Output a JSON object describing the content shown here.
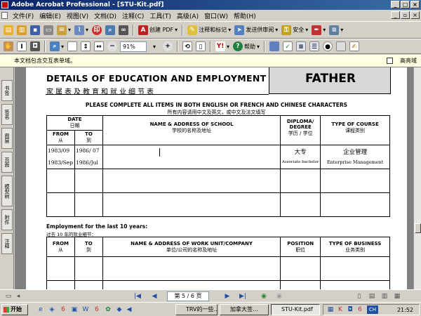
{
  "window": {
    "title": "Adobe Acrobat Professional - [STU-Kit.pdf]"
  },
  "menu": [
    "文件(F)",
    "编辑(E)",
    "视图(V)",
    "文档(D)",
    "注释(C)",
    "工具(T)",
    "高级(A)",
    "窗口(W)",
    "帮助(H)"
  ],
  "toolbar1": {
    "create_pdf": "创建 PDF",
    "comment": "注释和标记",
    "send_review": "发送供审阅",
    "security": "安全"
  },
  "toolbar2": {
    "zoom": "91%",
    "help": "帮助"
  },
  "message_bar": {
    "text": "本文档包含交互表单域。",
    "highlight_label": "高亮域"
  },
  "left_tabs": [
    "书签",
    "签名",
    "图层",
    "页面",
    "模型树",
    "附件",
    "注释"
  ],
  "document": {
    "title": "DETAILS OF EDUCATION AND EMPLOYMENT",
    "title_cn": "家属表及教育和就业细节表",
    "father": "FATHER",
    "instruction": "PLEASE COMPLETE ALL ITEMS IN BOTH ENGLISH OR FRENCH AND CHINESE CHARACTERS",
    "instruction_cn": "所有内容请用中文及英文，或中文及法文填写",
    "education": {
      "date": "DATE",
      "date_cn": "日期",
      "from": "FROM",
      "from_cn": "从",
      "to": "TO",
      "to_cn": "到",
      "school": "NAME & ADDRESS OF SCHOOL",
      "school_cn": "学校的名称及地址",
      "diploma": "DIPLOMA/ DEGREE",
      "diploma_cn": "学历 / 学位",
      "course": "TYPE OF COURSE",
      "course_cn": "课程类别",
      "row1": {
        "from": "1983/09",
        "to": "1986/ 07",
        "diploma": "大专",
        "course": "企业管理"
      },
      "row2": {
        "from": "1983/Sep",
        "to": "1986/Jul",
        "diploma": "Associate bachelor",
        "course": "Enterprise  Management"
      }
    },
    "employment": {
      "title": "Employment for the last 10 years:",
      "title_cn": "过去 10 年的就业细节：",
      "from": "FROM",
      "from_cn": "从",
      "to": "TO",
      "to_cn": "到",
      "company": "NAME & ADDRESS OF WORK UNIT/COMPANY",
      "company_cn": "单位/公司的名称及地址",
      "position": "POSITION",
      "position_cn": "职位",
      "business": "TYPE OF BUSINESS",
      "business_cn": "业务类别"
    }
  },
  "statusbar": {
    "page": "第 5 / 6 页"
  },
  "taskbar": {
    "start": "开始",
    "tasks": [
      "TRV的一些...",
      "加拿大签...",
      "STU-Kit.pdf"
    ],
    "clock": "21:52",
    "ime": "CH"
  }
}
